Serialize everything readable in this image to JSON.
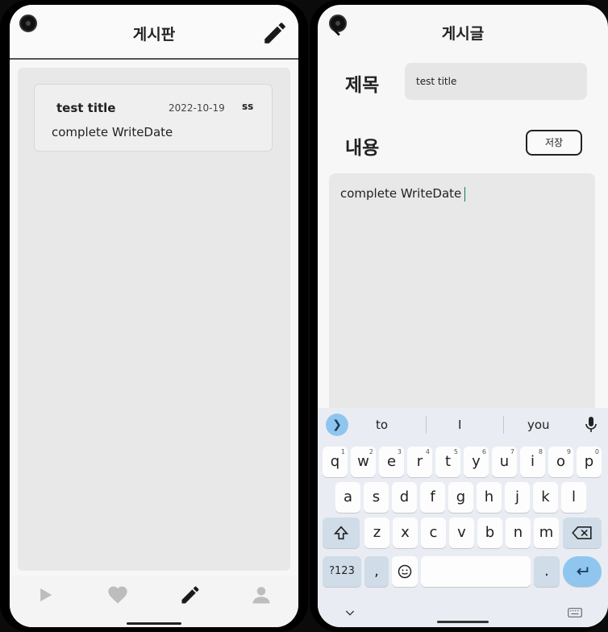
{
  "board_screen": {
    "title": "게시판",
    "posts": [
      {
        "title": "test title",
        "date": "2022-10-19",
        "author": "ss",
        "content": "complete WriteDate"
      }
    ],
    "nav": [
      "play-icon",
      "heart-icon",
      "pencil-icon",
      "person-icon"
    ]
  },
  "write_screen": {
    "title": "게시글",
    "title_label": "제목",
    "title_value": "test title",
    "content_label": "내용",
    "save_label": "저장",
    "content_value": "complete WriteDate"
  },
  "keyboard": {
    "suggestions": [
      "to",
      "I",
      "you"
    ],
    "row1": [
      {
        "k": "q",
        "n": "1"
      },
      {
        "k": "w",
        "n": "2"
      },
      {
        "k": "e",
        "n": "3"
      },
      {
        "k": "r",
        "n": "4"
      },
      {
        "k": "t",
        "n": "5"
      },
      {
        "k": "y",
        "n": "6"
      },
      {
        "k": "u",
        "n": "7"
      },
      {
        "k": "i",
        "n": "8"
      },
      {
        "k": "o",
        "n": "9"
      },
      {
        "k": "p",
        "n": "0"
      }
    ],
    "row2": [
      "a",
      "s",
      "d",
      "f",
      "g",
      "h",
      "j",
      "k",
      "l"
    ],
    "row3": [
      "z",
      "x",
      "c",
      "v",
      "b",
      "n",
      "m"
    ],
    "symbols_label": "?123",
    "comma_label": ",",
    "period_label": "."
  }
}
